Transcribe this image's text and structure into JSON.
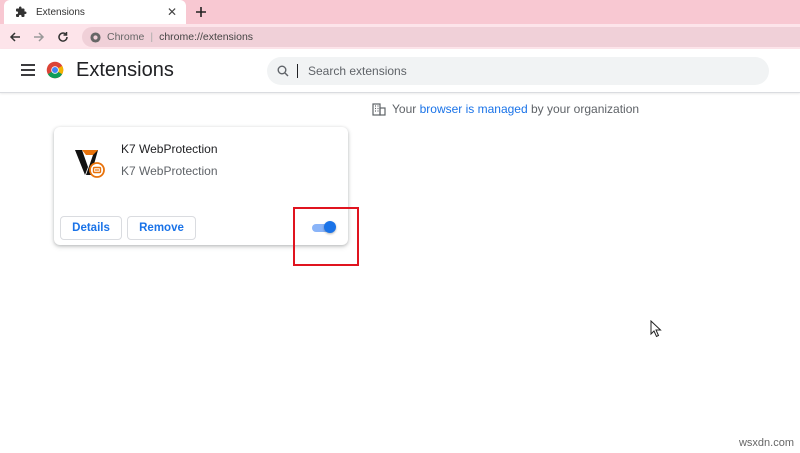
{
  "browser": {
    "tab": {
      "title": "Extensions",
      "icon": "puzzle-icon"
    },
    "omnibox": {
      "site_label": "Chrome",
      "separator": "|",
      "url": "chrome://extensions"
    }
  },
  "header": {
    "title": "Extensions",
    "search": {
      "placeholder": "Search extensions",
      "value": ""
    }
  },
  "managed_notice": {
    "prefix": "Your ",
    "link": "browser is managed",
    "suffix": " by your organization"
  },
  "extension": {
    "name": "K7 WebProtection",
    "description": "K7 WebProtection",
    "details_label": "Details",
    "remove_label": "Remove",
    "enabled": true
  },
  "colors": {
    "accent": "#1a73e8",
    "toggle_track": "#8ab4f8",
    "highlight": "#e0141f",
    "tabstrip": "#f8c8d2"
  },
  "watermark": "wsxdn.com"
}
